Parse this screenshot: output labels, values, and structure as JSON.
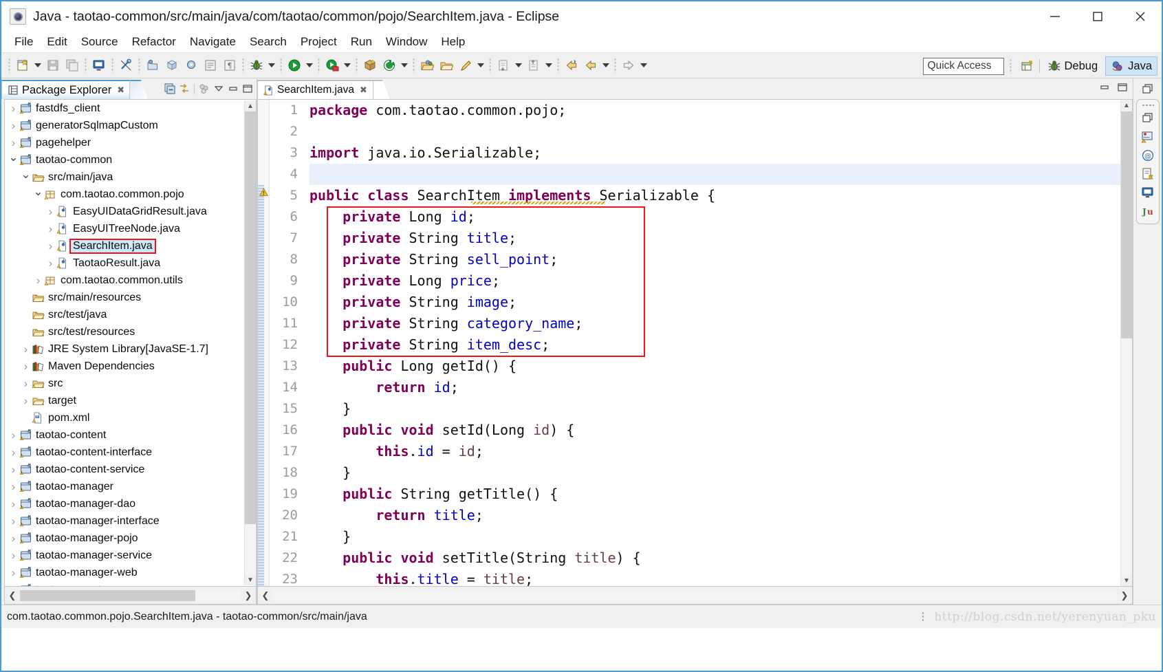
{
  "window": {
    "title": "Java - taotao-common/src/main/java/com/taotao/common/pojo/SearchItem.java - Eclipse",
    "app_icon": "eclipse-icon",
    "controls": {
      "minimize": "–",
      "maximize": "□",
      "close": "✕"
    }
  },
  "menubar": {
    "items": [
      "File",
      "Edit",
      "Source",
      "Refactor",
      "Navigate",
      "Search",
      "Project",
      "Run",
      "Window",
      "Help"
    ]
  },
  "toolbar": {
    "groups": [
      {
        "buttons": [
          {
            "name": "new-wizard-icon",
            "arrow": true
          },
          {
            "name": "save-icon",
            "arrow": false
          },
          {
            "name": "save-all-icon",
            "arrow": false
          }
        ]
      },
      {
        "buttons": [
          {
            "name": "print-icon",
            "arrow": false
          }
        ]
      },
      {
        "buttons": [
          {
            "name": "toggle-ref-icon",
            "arrow": false
          }
        ]
      },
      {
        "buttons": [
          {
            "name": "new-java-project-icon",
            "arrow": false
          },
          {
            "name": "new-package-icon",
            "arrow": false
          },
          {
            "name": "new-class-icon",
            "arrow": false
          },
          {
            "name": "open-type-icon",
            "arrow": false
          },
          {
            "name": "format-icon",
            "arrow": false
          }
        ]
      },
      {
        "buttons": [
          {
            "name": "debug-icon",
            "arrow": true
          }
        ]
      },
      {
        "buttons": [
          {
            "name": "run-icon",
            "arrow": true
          }
        ]
      },
      {
        "buttons": [
          {
            "name": "run-server-icon",
            "arrow": true
          }
        ]
      },
      {
        "buttons": [
          {
            "name": "new-maven-icon",
            "arrow": false
          },
          {
            "name": "refresh-maven-icon",
            "arrow": true
          }
        ]
      },
      {
        "buttons": [
          {
            "name": "open-folder-icon",
            "arrow": false
          },
          {
            "name": "open-resource-icon",
            "arrow": false
          },
          {
            "name": "search-pencil-icon",
            "arrow": true
          }
        ]
      },
      {
        "buttons": [
          {
            "name": "previous-annotation-icon",
            "arrow": true
          },
          {
            "name": "next-annotation-icon",
            "arrow": true
          }
        ]
      },
      {
        "buttons": [
          {
            "name": "back-history-icon",
            "arrow": false
          },
          {
            "name": "forward-history-icon",
            "arrow": true
          }
        ]
      },
      {
        "buttons": [
          {
            "name": "forward-nav-icon",
            "arrow": true
          }
        ]
      }
    ],
    "quick_access_placeholder": "Quick Access",
    "open-perspective-icon": "open-perspective-icon",
    "perspectives": [
      {
        "name": "perspective-debug",
        "label": "Debug",
        "icon": "bug-icon",
        "active": false
      },
      {
        "name": "perspective-java",
        "label": "Java",
        "icon": "java-icon",
        "active": true
      }
    ]
  },
  "package_explorer": {
    "tab_title": "Package Explorer",
    "tab_close": "✖",
    "toolbar_icons": [
      "collapse-all-icon",
      "link-with-editor-icon",
      "focus-on-active-task-icon",
      "view-menu-icon",
      "minimize-icon",
      "maximize-icon"
    ],
    "tree": [
      {
        "label": "fastdfs_client",
        "indent": 0,
        "twisty": "closed",
        "icon": "maven-project-icon"
      },
      {
        "label": "generatorSqlmapCustom",
        "indent": 0,
        "twisty": "closed",
        "icon": "maven-project-icon"
      },
      {
        "label": "pagehelper",
        "indent": 0,
        "twisty": "closed",
        "icon": "maven-project-icon"
      },
      {
        "label": "taotao-common",
        "indent": 0,
        "twisty": "open",
        "icon": "maven-project-icon"
      },
      {
        "label": "src/main/java",
        "indent": 1,
        "twisty": "open",
        "icon": "source-folder-icon"
      },
      {
        "label": "com.taotao.common.pojo",
        "indent": 2,
        "twisty": "open",
        "icon": "package-icon"
      },
      {
        "label": "EasyUIDataGridResult.java",
        "indent": 3,
        "twisty": "closed",
        "icon": "java-file-icon"
      },
      {
        "label": "EasyUITreeNode.java",
        "indent": 3,
        "twisty": "closed",
        "icon": "java-file-icon"
      },
      {
        "label": "SearchItem.java",
        "indent": 3,
        "twisty": "closed",
        "icon": "java-file-icon",
        "selected": true
      },
      {
        "label": "TaotaoResult.java",
        "indent": 3,
        "twisty": "closed",
        "icon": "java-file-icon"
      },
      {
        "label": "com.taotao.common.utils",
        "indent": 2,
        "twisty": "closed",
        "icon": "package-icon"
      },
      {
        "label": "src/main/resources",
        "indent": 1,
        "twisty": "none",
        "icon": "source-folder-icon"
      },
      {
        "label": "src/test/java",
        "indent": 1,
        "twisty": "none",
        "icon": "source-folder-icon"
      },
      {
        "label": "src/test/resources",
        "indent": 1,
        "twisty": "none",
        "icon": "source-folder-icon"
      },
      {
        "label": "JRE System Library ",
        "dim": "[JavaSE-1.7]",
        "indent": 1,
        "twisty": "closed",
        "icon": "library-icon"
      },
      {
        "label": "Maven Dependencies",
        "indent": 1,
        "twisty": "closed",
        "icon": "library-icon"
      },
      {
        "label": "src",
        "indent": 1,
        "twisty": "closed",
        "icon": "folder-jar-icon"
      },
      {
        "label": "target",
        "indent": 1,
        "twisty": "closed",
        "icon": "folder-icon"
      },
      {
        "label": "pom.xml",
        "indent": 1,
        "twisty": "none",
        "icon": "pom-file-icon"
      },
      {
        "label": "taotao-content",
        "indent": 0,
        "twisty": "closed",
        "icon": "maven-project-icon"
      },
      {
        "label": "taotao-content-interface",
        "indent": 0,
        "twisty": "closed",
        "icon": "maven-project-icon"
      },
      {
        "label": "taotao-content-service",
        "indent": 0,
        "twisty": "closed",
        "icon": "maven-project-icon"
      },
      {
        "label": "taotao-manager",
        "indent": 0,
        "twisty": "closed",
        "icon": "maven-project-icon"
      },
      {
        "label": "taotao-manager-dao",
        "indent": 0,
        "twisty": "closed",
        "icon": "maven-project-icon"
      },
      {
        "label": "taotao-manager-interface",
        "indent": 0,
        "twisty": "closed",
        "icon": "maven-project-icon"
      },
      {
        "label": "taotao-manager-pojo",
        "indent": 0,
        "twisty": "closed",
        "icon": "maven-project-icon"
      },
      {
        "label": "taotao-manager-service",
        "indent": 0,
        "twisty": "closed",
        "icon": "maven-project-icon"
      },
      {
        "label": "taotao-manager-web",
        "indent": 0,
        "twisty": "closed",
        "icon": "maven-project-icon"
      },
      {
        "label": "taotao-parent",
        "indent": 0,
        "twisty": "closed",
        "icon": "maven-project-icon"
      }
    ]
  },
  "editor": {
    "tab_title": "SearchItem.java",
    "tab_close": "✖",
    "tab_icon": "java-file-warning-icon",
    "highlighted_line": 4,
    "annotation_box": {
      "from_line": 6,
      "to_line": 12,
      "color": "#f01414"
    },
    "lines": [
      {
        "n": 1,
        "fold": false,
        "tokens": [
          {
            "t": "package",
            "c": "kw"
          },
          {
            "t": " com.taotao.common.pojo;",
            "c": "pln"
          }
        ]
      },
      {
        "n": 2,
        "fold": false,
        "tokens": [
          {
            "t": "",
            "c": "pln"
          }
        ]
      },
      {
        "n": 3,
        "fold": false,
        "tokens": [
          {
            "t": "import",
            "c": "kw"
          },
          {
            "t": " java.io.Serializable;",
            "c": "pln"
          }
        ]
      },
      {
        "n": 4,
        "fold": false,
        "tokens": [
          {
            "t": "",
            "c": "pln"
          }
        ]
      },
      {
        "n": 5,
        "fold": false,
        "tokens": [
          {
            "t": "public class",
            "c": "kw"
          },
          {
            "t": " SearchItem ",
            "c": "typ"
          },
          {
            "t": "implements",
            "c": "kw"
          },
          {
            "t": " Serializable {",
            "c": "typ"
          }
        ]
      },
      {
        "n": 6,
        "fold": false,
        "tokens": [
          {
            "t": "    ",
            "c": "pln"
          },
          {
            "t": "private",
            "c": "kw"
          },
          {
            "t": " Long ",
            "c": "typ"
          },
          {
            "t": "id",
            "c": "fld"
          },
          {
            "t": ";",
            "c": "pln"
          }
        ]
      },
      {
        "n": 7,
        "fold": false,
        "tokens": [
          {
            "t": "    ",
            "c": "pln"
          },
          {
            "t": "private",
            "c": "kw"
          },
          {
            "t": " String ",
            "c": "typ"
          },
          {
            "t": "title",
            "c": "fld"
          },
          {
            "t": ";",
            "c": "pln"
          }
        ]
      },
      {
        "n": 8,
        "fold": false,
        "tokens": [
          {
            "t": "    ",
            "c": "pln"
          },
          {
            "t": "private",
            "c": "kw"
          },
          {
            "t": " String ",
            "c": "typ"
          },
          {
            "t": "sell_point",
            "c": "fld"
          },
          {
            "t": ";",
            "c": "pln"
          }
        ]
      },
      {
        "n": 9,
        "fold": false,
        "tokens": [
          {
            "t": "    ",
            "c": "pln"
          },
          {
            "t": "private",
            "c": "kw"
          },
          {
            "t": " Long ",
            "c": "typ"
          },
          {
            "t": "price",
            "c": "fld"
          },
          {
            "t": ";",
            "c": "pln"
          }
        ]
      },
      {
        "n": 10,
        "fold": false,
        "tokens": [
          {
            "t": "    ",
            "c": "pln"
          },
          {
            "t": "private",
            "c": "kw"
          },
          {
            "t": " String ",
            "c": "typ"
          },
          {
            "t": "image",
            "c": "fld"
          },
          {
            "t": ";",
            "c": "pln"
          }
        ]
      },
      {
        "n": 11,
        "fold": false,
        "tokens": [
          {
            "t": "    ",
            "c": "pln"
          },
          {
            "t": "private",
            "c": "kw"
          },
          {
            "t": " String ",
            "c": "typ"
          },
          {
            "t": "category_name",
            "c": "fld"
          },
          {
            "t": ";",
            "c": "pln"
          }
        ]
      },
      {
        "n": 12,
        "fold": false,
        "tokens": [
          {
            "t": "    ",
            "c": "pln"
          },
          {
            "t": "private",
            "c": "kw"
          },
          {
            "t": " String ",
            "c": "typ"
          },
          {
            "t": "item_desc",
            "c": "fld"
          },
          {
            "t": ";",
            "c": "pln"
          }
        ]
      },
      {
        "n": 13,
        "fold": true,
        "tokens": [
          {
            "t": "    ",
            "c": "pln"
          },
          {
            "t": "public",
            "c": "kw"
          },
          {
            "t": " Long getId() {",
            "c": "typ"
          }
        ]
      },
      {
        "n": 14,
        "fold": false,
        "tokens": [
          {
            "t": "        ",
            "c": "pln"
          },
          {
            "t": "return",
            "c": "kw"
          },
          {
            "t": " ",
            "c": "pln"
          },
          {
            "t": "id",
            "c": "fld"
          },
          {
            "t": ";",
            "c": "pln"
          }
        ]
      },
      {
        "n": 15,
        "fold": false,
        "tokens": [
          {
            "t": "    }",
            "c": "pln"
          }
        ]
      },
      {
        "n": 16,
        "fold": true,
        "tokens": [
          {
            "t": "    ",
            "c": "pln"
          },
          {
            "t": "public void",
            "c": "kw"
          },
          {
            "t": " setId(Long ",
            "c": "typ"
          },
          {
            "t": "id",
            "c": "prm"
          },
          {
            "t": ") {",
            "c": "typ"
          }
        ]
      },
      {
        "n": 17,
        "fold": false,
        "tokens": [
          {
            "t": "        ",
            "c": "pln"
          },
          {
            "t": "this",
            "c": "kw"
          },
          {
            "t": ".",
            "c": "pln"
          },
          {
            "t": "id",
            "c": "fld"
          },
          {
            "t": " = ",
            "c": "pln"
          },
          {
            "t": "id",
            "c": "prm"
          },
          {
            "t": ";",
            "c": "pln"
          }
        ]
      },
      {
        "n": 18,
        "fold": false,
        "tokens": [
          {
            "t": "    }",
            "c": "pln"
          }
        ]
      },
      {
        "n": 19,
        "fold": true,
        "tokens": [
          {
            "t": "    ",
            "c": "pln"
          },
          {
            "t": "public",
            "c": "kw"
          },
          {
            "t": " String getTitle() {",
            "c": "typ"
          }
        ]
      },
      {
        "n": 20,
        "fold": false,
        "tokens": [
          {
            "t": "        ",
            "c": "pln"
          },
          {
            "t": "return",
            "c": "kw"
          },
          {
            "t": " ",
            "c": "pln"
          },
          {
            "t": "title",
            "c": "fld"
          },
          {
            "t": ";",
            "c": "pln"
          }
        ]
      },
      {
        "n": 21,
        "fold": false,
        "tokens": [
          {
            "t": "    }",
            "c": "pln"
          }
        ]
      },
      {
        "n": 22,
        "fold": true,
        "tokens": [
          {
            "t": "    ",
            "c": "pln"
          },
          {
            "t": "public void",
            "c": "kw"
          },
          {
            "t": " setTitle(String ",
            "c": "typ"
          },
          {
            "t": "title",
            "c": "prm"
          },
          {
            "t": ") {",
            "c": "typ"
          }
        ]
      },
      {
        "n": 23,
        "fold": false,
        "tokens": [
          {
            "t": "        ",
            "c": "pln"
          },
          {
            "t": "this",
            "c": "kw"
          },
          {
            "t": ".",
            "c": "pln"
          },
          {
            "t": "title",
            "c": "fld"
          },
          {
            "t": " = ",
            "c": "pln"
          },
          {
            "t": "title",
            "c": "prm"
          },
          {
            "t": ";",
            "c": "pln"
          }
        ]
      }
    ]
  },
  "right_strip": {
    "restore_icon": "restore-view-icon",
    "fast_view_icons": [
      "restore-view-icon",
      "servers-view-icon",
      "console-at-icon",
      "outline-view-icon",
      "console-view-icon",
      "junit-view-icon"
    ]
  },
  "statusbar": {
    "text": "com.taotao.common.pojo.SearchItem.java - taotao-common/src/main/java",
    "watermark": "http://blog.csdn.net/yerenyuan_pku"
  },
  "colors": {
    "accent": "#4a9ad4",
    "selection": "#cde8f6",
    "annotation_red": "#f01414",
    "keyword": "#7f0055",
    "field": "#0000c0",
    "parameter": "#6a3e3e",
    "highlight_line": "#e8f1fb"
  }
}
